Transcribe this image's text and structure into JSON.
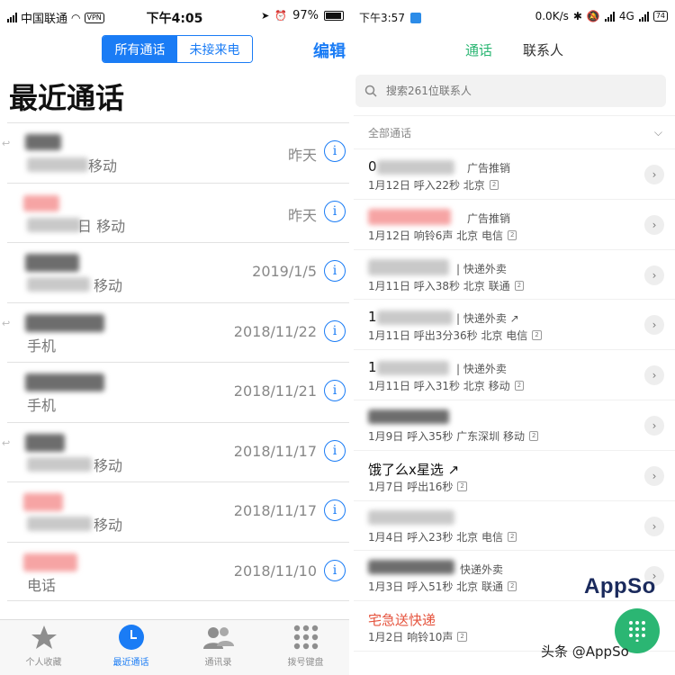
{
  "ios": {
    "status": {
      "carrier": "中国联通",
      "vpn": "VPN",
      "time": "下午4:05",
      "battery": "97%"
    },
    "segments": {
      "all": "所有通话",
      "missed": "未接来电"
    },
    "edit": "编辑",
    "title": "最近通话",
    "rows": [
      {
        "sub": "移动",
        "date": "昨天"
      },
      {
        "sub": "日 移动",
        "date": "昨天"
      },
      {
        "sub": "移动",
        "date": "2019/1/5"
      },
      {
        "sub": "手机",
        "date": "2018/11/22"
      },
      {
        "sub": "手机",
        "date": "2018/11/21"
      },
      {
        "sub": "移动",
        "date": "2018/11/17"
      },
      {
        "sub": "移动",
        "date": "2018/11/17"
      },
      {
        "sub": "电话",
        "date": "2018/11/10"
      }
    ],
    "tabs": [
      {
        "label": "个人收藏",
        "icon": "star-icon"
      },
      {
        "label": "最近通话",
        "icon": "clock-icon"
      },
      {
        "label": "通讯录",
        "icon": "contacts-icon"
      },
      {
        "label": "拨号键盘",
        "icon": "keypad-icon"
      }
    ],
    "colors": {
      "accent": "#1a7cf5"
    }
  },
  "android": {
    "status": {
      "time": "下午3:57",
      "speed": "0.0K/s",
      "network": "4G",
      "battery": "74"
    },
    "tabs": {
      "calls": "通话",
      "contacts": "联系人"
    },
    "search_placeholder": "搜索261位联系人",
    "filter": "全部通话",
    "rows": [
      {
        "name": "0",
        "tag": "广告推销",
        "meta": "1月12日 呼入22秒 北京"
      },
      {
        "name": "",
        "tag": "广告推销",
        "meta": "1月12日 响铃6声 北京 电信"
      },
      {
        "name": "",
        "tag": "| 快递外卖",
        "meta": "1月11日 呼入38秒 北京 联通"
      },
      {
        "name": "1",
        "tag": "| 快递外卖 ↗",
        "meta": "1月11日 呼出3分36秒 北京 电信"
      },
      {
        "name": "1",
        "tag": "| 快递外卖",
        "meta": "1月11日 呼入31秒 北京 移动"
      },
      {
        "name": "",
        "tag": "",
        "meta": "1月9日 呼入35秒 广东深圳 移动"
      },
      {
        "name": "饿了么x星选 ↗",
        "tag": "",
        "meta": "1月7日 呼出16秒"
      },
      {
        "name": "",
        "tag": "",
        "meta": "1月4日 呼入23秒 北京 电信"
      },
      {
        "name": "",
        "tag": "快递外卖",
        "meta": "1月3日 呼入51秒 北京 联通"
      },
      {
        "name": "宅急送快递",
        "tag": "",
        "meta": "1月2日 响铃10声"
      }
    ],
    "colors": {
      "accent": "#2bb673",
      "red_name": "#e5533d"
    }
  },
  "watermarks": {
    "appso": "AppSo",
    "toutiao": "头条 @AppSo"
  }
}
